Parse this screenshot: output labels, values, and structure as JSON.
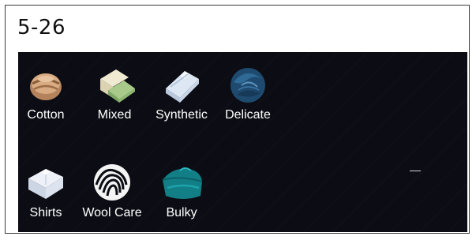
{
  "page": {
    "title": "5-26"
  },
  "programs": {
    "row1": [
      {
        "label": "Cotton",
        "icon": "cotton-fabric-icon"
      },
      {
        "label": "Mixed",
        "icon": "mixed-fabric-icon"
      },
      {
        "label": "Synthetic",
        "icon": "synthetic-fabric-icon"
      },
      {
        "label": "Delicate",
        "icon": "delicate-fabric-icon"
      }
    ],
    "row2": [
      {
        "label": "Shirts",
        "icon": "shirts-icon"
      },
      {
        "label": "Wool Care",
        "icon": "wool-care-icon"
      },
      {
        "label": "Bulky",
        "icon": "bulky-items-icon"
      }
    ]
  },
  "colors": {
    "screen_background": "#0c0d14",
    "label_text": "#ffffff"
  }
}
